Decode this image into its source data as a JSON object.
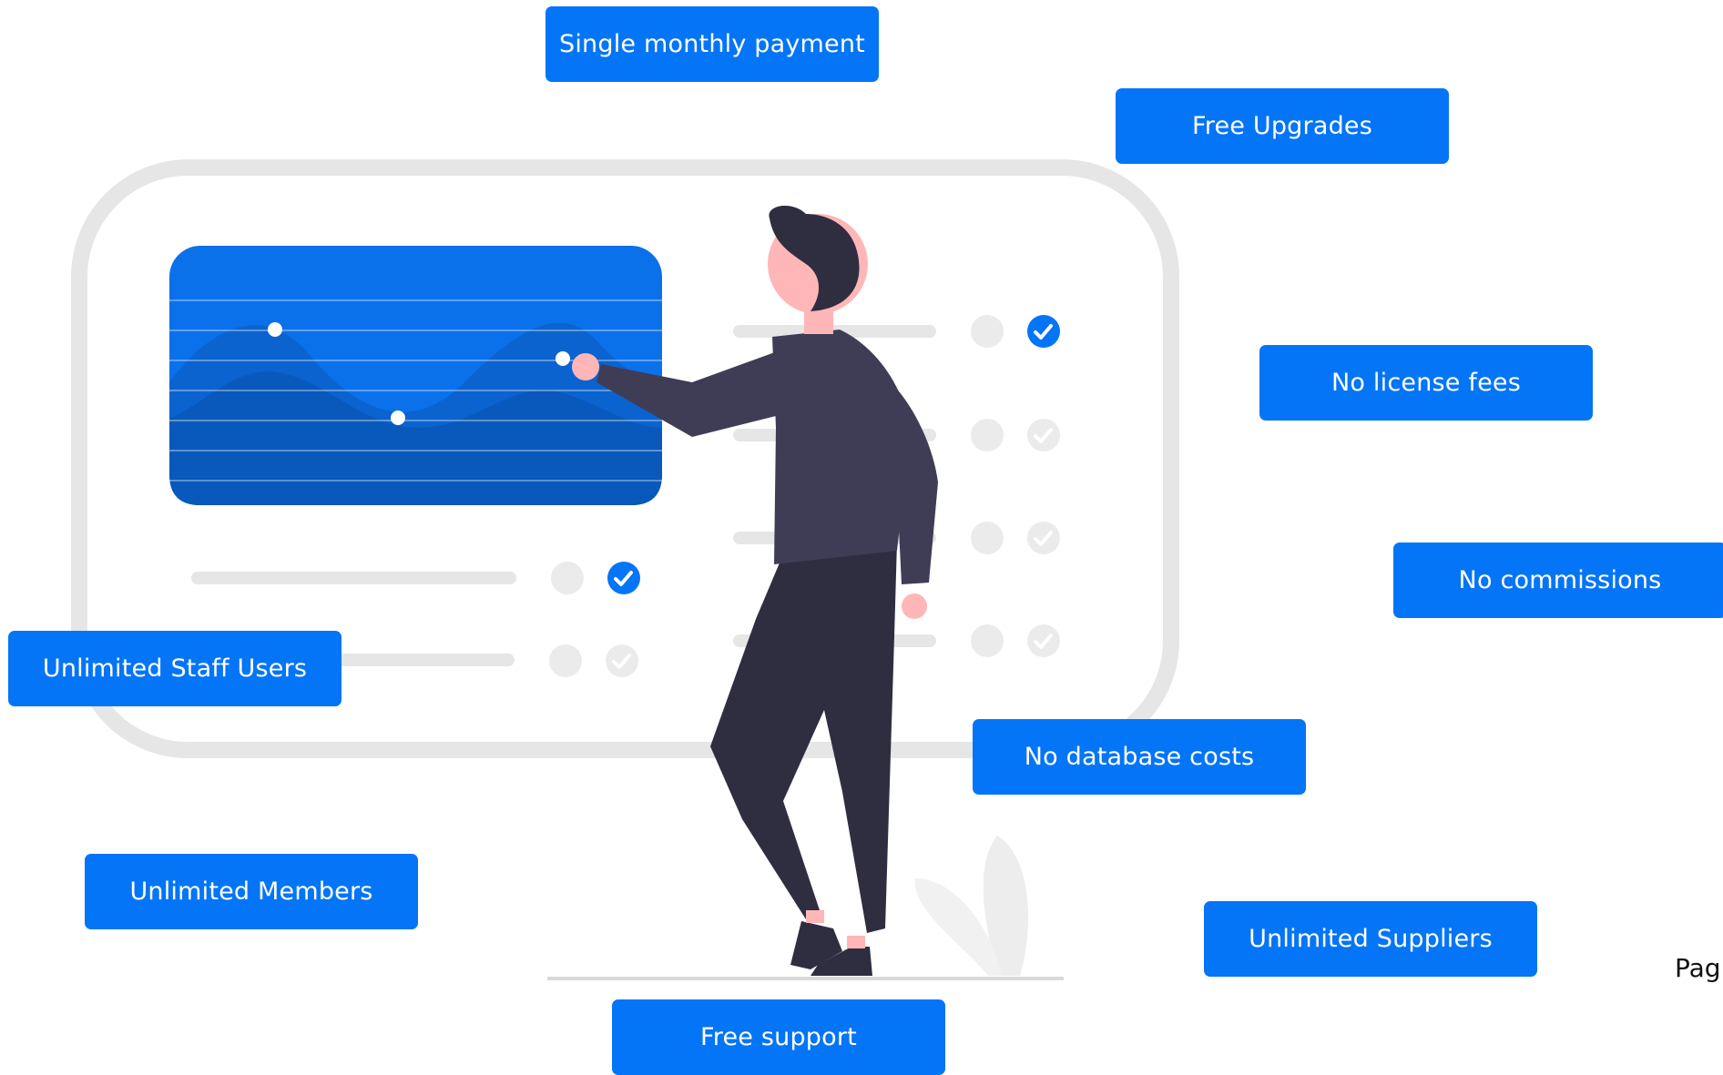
{
  "feature_tags": {
    "single_monthly_payment": "Single monthly payment",
    "free_upgrades": "Free Upgrades",
    "no_license_fees": "No license fees",
    "no_commissions": "No commissions",
    "unlimited_staff_users": "Unlimited Staff Users",
    "no_database_costs": "No database costs",
    "unlimited_members": "Unlimited Members",
    "unlimited_suppliers": "Unlimited Suppliers",
    "free_support": "Free support"
  },
  "page_label": "Pag",
  "colors": {
    "accent": "#0575f7",
    "panel_blue": "#0a6fe6",
    "outline_gray": "#e6e6e6",
    "person_dark": "#2f2e41",
    "skin": "#ffb6b6"
  }
}
